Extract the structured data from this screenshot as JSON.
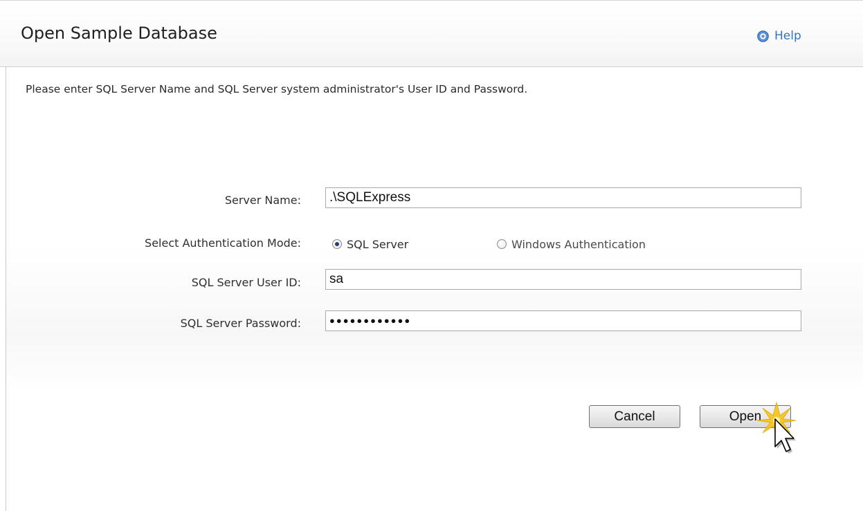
{
  "dialog": {
    "title": "Open Sample Database",
    "help_label": "Help",
    "instructions": "Please enter SQL Server Name and SQL Server system administrator's User ID and Password."
  },
  "form": {
    "server_name_label": "Server Name:",
    "server_name_value": ".\\SQLExpress",
    "auth_mode_label": "Select Authentication Mode:",
    "auth_options": [
      {
        "label": "SQL Server",
        "checked": true
      },
      {
        "label": "Windows Authentication",
        "checked": false
      }
    ],
    "user_id_label": "SQL Server User ID:",
    "user_id_value": "sa",
    "password_label": "SQL Server Password:",
    "password_mask": "●●●●●●●●●●●●"
  },
  "buttons": {
    "cancel_label": "Cancel",
    "open_label": "Open"
  },
  "icons": {
    "help": "help-icon",
    "cursor": "mouse-pointer-click-icon"
  },
  "colors": {
    "link": "#2f74c0",
    "highlight": "#f5c518"
  }
}
